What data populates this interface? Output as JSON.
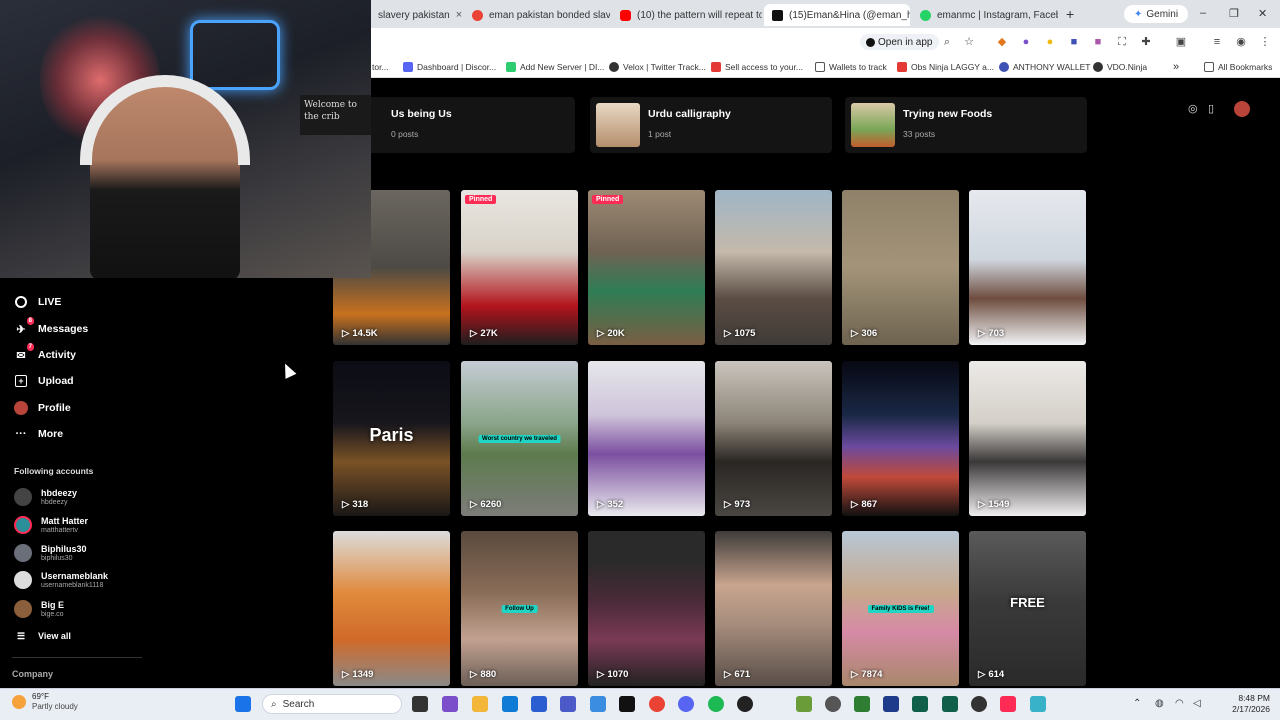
{
  "browser": {
    "tabs": [
      {
        "label": "slavery pakistan",
        "favicon_color": "#4285f4"
      },
      {
        "label": "eman pakistan bonded slaver",
        "favicon_color": "#ea4335"
      },
      {
        "label": "(10) the pattern will repeat to",
        "favicon_color": "#ff0000"
      },
      {
        "label": "(15)Eman&Hina (@eman_hin",
        "favicon_color": "#111111"
      },
      {
        "label": "emanmc | Instagram, Faceboo",
        "favicon_color": "#25d366"
      }
    ],
    "new_tab": "+",
    "gemini_label": "Gemini",
    "window_controls": [
      "–",
      "❐",
      "✕"
    ],
    "open_in_app": "Open in app",
    "bookmarks": [
      {
        "label": "tor...",
        "color": "#888888"
      },
      {
        "label": "Dashboard | Discor...",
        "color": "#5865f2"
      },
      {
        "label": "Add New Server | DI...",
        "color": "#2ecc71"
      },
      {
        "label": "Velox | Twitter Track...",
        "color": "#333333"
      },
      {
        "label": "Sell access to your...",
        "color": "#e53935"
      },
      {
        "label": "Wallets to track",
        "color": "#555555"
      },
      {
        "label": "Obs Ninja LAGGY a...",
        "color": "#e53935"
      },
      {
        "label": "ANTHONY WALLET",
        "color": "#3f51b5"
      },
      {
        "label": "VDO.Ninja",
        "color": "#333333"
      },
      {
        "label": "»",
        "color": "#ffffff"
      },
      {
        "label": "All Bookmarks",
        "color": "#555555"
      }
    ]
  },
  "webcam": {
    "sign_text": "Welcome to the crib"
  },
  "sidebar": {
    "nav": [
      {
        "label": "LIVE",
        "icon": "live-icon",
        "badge": ""
      },
      {
        "label": "Messages",
        "icon": "messages-icon",
        "badge": "8"
      },
      {
        "label": "Activity",
        "icon": "activity-icon",
        "badge": "7"
      },
      {
        "label": "Upload",
        "icon": "upload-icon",
        "badge": ""
      },
      {
        "label": "Profile",
        "icon": "profile-icon",
        "badge": ""
      },
      {
        "label": "More",
        "icon": "more-icon",
        "badge": ""
      }
    ],
    "following_title": "Following accounts",
    "following": [
      {
        "name": "hbdeezy",
        "handle": "hbdeezy",
        "color": "#444444"
      },
      {
        "name": "Matt Hatter",
        "handle": "matthattertv",
        "color": "#2a8f99"
      },
      {
        "name": "Biphilus30",
        "handle": "biphilus30",
        "color": "#6b6f7a"
      },
      {
        "name": "Usernameblank",
        "handle": "usernameblank1118",
        "color": "#dddddd"
      },
      {
        "name": "Big E",
        "handle": "bige.co",
        "color": "#8b5e3c"
      }
    ],
    "view_all": "View all",
    "company": "Company"
  },
  "collections": [
    {
      "title": "Us being Us",
      "count": "0 posts",
      "thumb_color": "#141414"
    },
    {
      "title": "Urdu calligraphy",
      "count": "1 post",
      "thumb_color": "#c9a27a"
    },
    {
      "title": "Trying new Foods",
      "count": "33 posts",
      "thumb_color": "#7aa657"
    }
  ],
  "videos": [
    {
      "views": "14.5K",
      "pinned": "",
      "overlay": "",
      "tag": "",
      "bg": "linear-gradient(180deg,#6b6660,#4d4a45 50%,#c8711e 80%,#333)"
    },
    {
      "views": "27K",
      "pinned": "Pinned",
      "overlay": "",
      "tag": "",
      "bg": "linear-gradient(180deg,#e9e6e1,#d8d2c8 40%,#b3131c 75%,#1e1e1e)"
    },
    {
      "views": "20K",
      "pinned": "Pinned",
      "overlay": "",
      "tag": "",
      "bg": "linear-gradient(180deg,#9e8a74,#6f6253 40%,#2f7d55 65%,#7a5e44)"
    },
    {
      "views": "1075",
      "pinned": "",
      "overlay": "",
      "tag": "",
      "bg": "linear-gradient(180deg,#9fb6c6,#c4b9ab 40%,#5b4d44 70%,#3f3a36)"
    },
    {
      "views": "306",
      "pinned": "",
      "overlay": "",
      "tag": "",
      "bg": "linear-gradient(180deg,#8f8169,#a39479 50%,#6e6350)"
    },
    {
      "views": "703",
      "pinned": "",
      "overlay": "",
      "tag": "",
      "bg": "linear-gradient(180deg,#e6e9ee,#cfd6de 45%,#6e4d3f 70%,#f2f4f6)"
    },
    {
      "views": "318",
      "pinned": "",
      "overlay": "Paris",
      "tag": "",
      "bg": "linear-gradient(180deg,#0c0c14,#17161d 40%,#7a5226 65%,#1a1716)"
    },
    {
      "views": "6260",
      "pinned": "",
      "overlay": "",
      "tag": "Worst country we traveled",
      "bg": "linear-gradient(180deg,#c5ccd4,#8aa58a 40%,#5d7b4e 60%,#7d7d7a)"
    },
    {
      "views": "352",
      "pinned": "",
      "overlay": "",
      "tag": "",
      "bg": "linear-gradient(180deg,#e5e6ea,#cfc4da 35%,#7b4fa0 60%,#e9e9ee)"
    },
    {
      "views": "973",
      "pinned": "",
      "overlay": "",
      "tag": "",
      "bg": "linear-gradient(180deg,#c9c4bd,#8c8478 40%,#2a2623 65%,#4a4743)"
    },
    {
      "views": "867",
      "pinned": "",
      "overlay": "",
      "tag": "",
      "bg": "linear-gradient(180deg,#070812,#1a2846 35%,#6a4a9e 55%,#c04a3a 75%,#111)"
    },
    {
      "views": "1549",
      "pinned": "",
      "overlay": "",
      "tag": "",
      "bg": "linear-gradient(180deg,#eceae7,#d4cfc8 40%,#3a3838 65%,#f0eeee)"
    },
    {
      "views": "1349",
      "pinned": "",
      "overlay": "",
      "tag": "",
      "bg": "linear-gradient(180deg,#dcdcdc,#e08a3c 40%,#d06a2a 70%,#8a8a8a)"
    },
    {
      "views": "880",
      "pinned": "",
      "overlay": "",
      "tag": "Follow Up",
      "bg": "linear-gradient(180deg,#5a4a3e,#8a6d58 40%,#c2a190 70%,#6c5f57)"
    },
    {
      "views": "1070",
      "pinned": "",
      "overlay": "",
      "tag": "",
      "bg": "linear-gradient(180deg,#2a2a2a,#2a2a2a 20%,#4a2a38 45%,#7a3a55 70%,#222)"
    },
    {
      "views": "671",
      "pinned": "",
      "overlay": "",
      "tag": "",
      "bg": "linear-gradient(180deg,#3e3b3a,#c9a58e 35%,#a68d7d 60%,#5a4e48)"
    },
    {
      "views": "7874",
      "pinned": "",
      "overlay": "",
      "tag": "Family KIDS is Free!",
      "bg": "linear-gradient(180deg,#b7c7d6,#c7a88c 40%,#d68aa6 65%,#a9876b)"
    },
    {
      "views": "614",
      "pinned": "",
      "overlay": "FREE",
      "tag": "",
      "bg": "linear-gradient(180deg,#5a5a5a,#3a3a3a 45%,#2a2a2a)"
    }
  ],
  "taskbar": {
    "weather_temp": "69°F",
    "weather_desc": "Partly cloudy",
    "search_label": "Search",
    "time": "8:48 PM",
    "date": "2/17/2026"
  }
}
